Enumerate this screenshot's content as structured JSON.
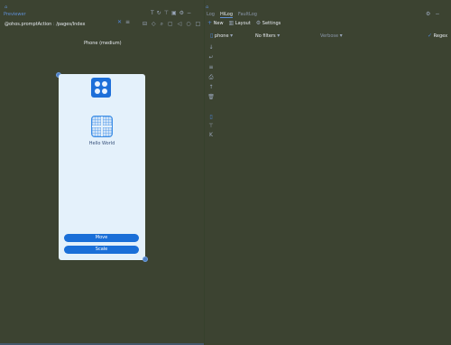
{
  "left_panel": {
    "title": "Previewer",
    "breadcrumb": "@ohos.promptAction",
    "breadcrumb_sep": "Index",
    "path": "/pages/Index",
    "toolbar_icons": [
      "theme-icon",
      "refresh-icon",
      "pin-icon",
      "expand-icon",
      "settings-icon",
      "minimize-icon"
    ],
    "device_label": "Phone (medium)"
  },
  "phone": {
    "hello_text": "Hello World",
    "buttons": [
      "Move",
      "Scale"
    ]
  },
  "right_panel": {
    "tabs": [
      "Log",
      "HiLog",
      "FaultLog"
    ],
    "toolbar": {
      "new_label": "New",
      "layout_label": "Layout",
      "settings_label": "Settings"
    },
    "filters": {
      "device": "phone",
      "filter": "No filters",
      "level": "Verbose",
      "regex_label": "Regex"
    }
  }
}
